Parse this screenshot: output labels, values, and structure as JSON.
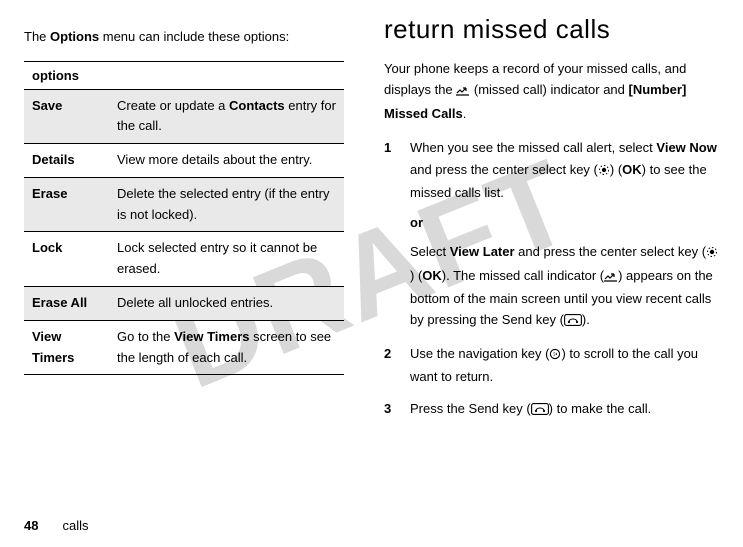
{
  "watermark": "DRAFT",
  "left": {
    "intro_pre": "The ",
    "intro_menu": "Options",
    "intro_post": " menu can include these options:",
    "table_header": "options",
    "rows": [
      {
        "name": "Save",
        "desc_pre": "Create or update a ",
        "desc_bold": "Contacts",
        "desc_post": " entry for the call."
      },
      {
        "name": "Details",
        "desc": "View more details about the entry."
      },
      {
        "name": "Erase",
        "desc": "Delete the selected entry (if the entry is not locked)."
      },
      {
        "name": "Lock",
        "desc": "Lock selected entry so it cannot be erased."
      },
      {
        "name": "Erase All",
        "desc": "Delete all unlocked entries."
      },
      {
        "name": "View Timers",
        "desc_pre": "Go to the ",
        "desc_bold": "View Timers",
        "desc_post": " screen to see the length of each call."
      }
    ]
  },
  "right": {
    "heading": "return missed calls",
    "p1_a": "Your phone keeps a record of your missed calls, and displays the ",
    "p1_b": " (missed call) indicator and ",
    "p1_c": "[Number] Missed Calls",
    "p1_d": ".",
    "step1": {
      "num": "1",
      "a": "When you see the missed call alert, select ",
      "viewnow": "View Now",
      "b": " and press the center select key (",
      "c": ") (",
      "ok": "OK",
      "d": ") to see the missed calls list.",
      "or": "or",
      "e": "Select ",
      "viewlater": "View Later",
      "f": " and press the center select key (",
      "g": ") (",
      "h": "). The missed call indicator (",
      "i": ") appears on the bottom of the main screen until you view recent calls by pressing the Send key (",
      "j": ")."
    },
    "step2": {
      "num": "2",
      "a": "Use the navigation key (",
      "b": ") to scroll to the call you want to return."
    },
    "step3": {
      "num": "3",
      "a": "Press the Send key (",
      "b": ") to make the call."
    }
  },
  "footer": {
    "page": "48",
    "section": "calls"
  }
}
